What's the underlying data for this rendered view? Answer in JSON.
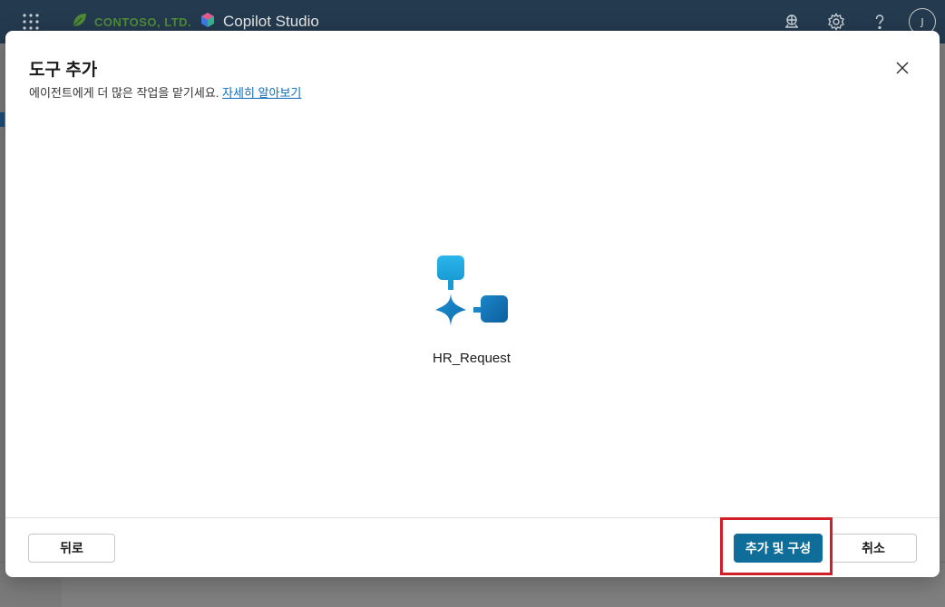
{
  "topbar": {
    "brand": "CONTOSO, LTD.",
    "product": "Copilot Studio",
    "avatar_initial": "J",
    "icons": [
      "waffle-icon",
      "environment-icon",
      "settings-icon",
      "help-icon"
    ]
  },
  "dialog": {
    "title": "도구 추가",
    "subtitle": "에이전트에게 더 많은 작업을 맡기세요.",
    "learn_more": "자세히 알아보기",
    "tool_name": "HR_Request",
    "buttons": {
      "back": "뒤로",
      "add_configure": "추가 및 구성",
      "cancel": "취소"
    }
  },
  "colors": {
    "topbar": "#243a4e",
    "primary": "#0f6e99",
    "highlight": "#d11f2a",
    "link": "#0f6cbd"
  }
}
